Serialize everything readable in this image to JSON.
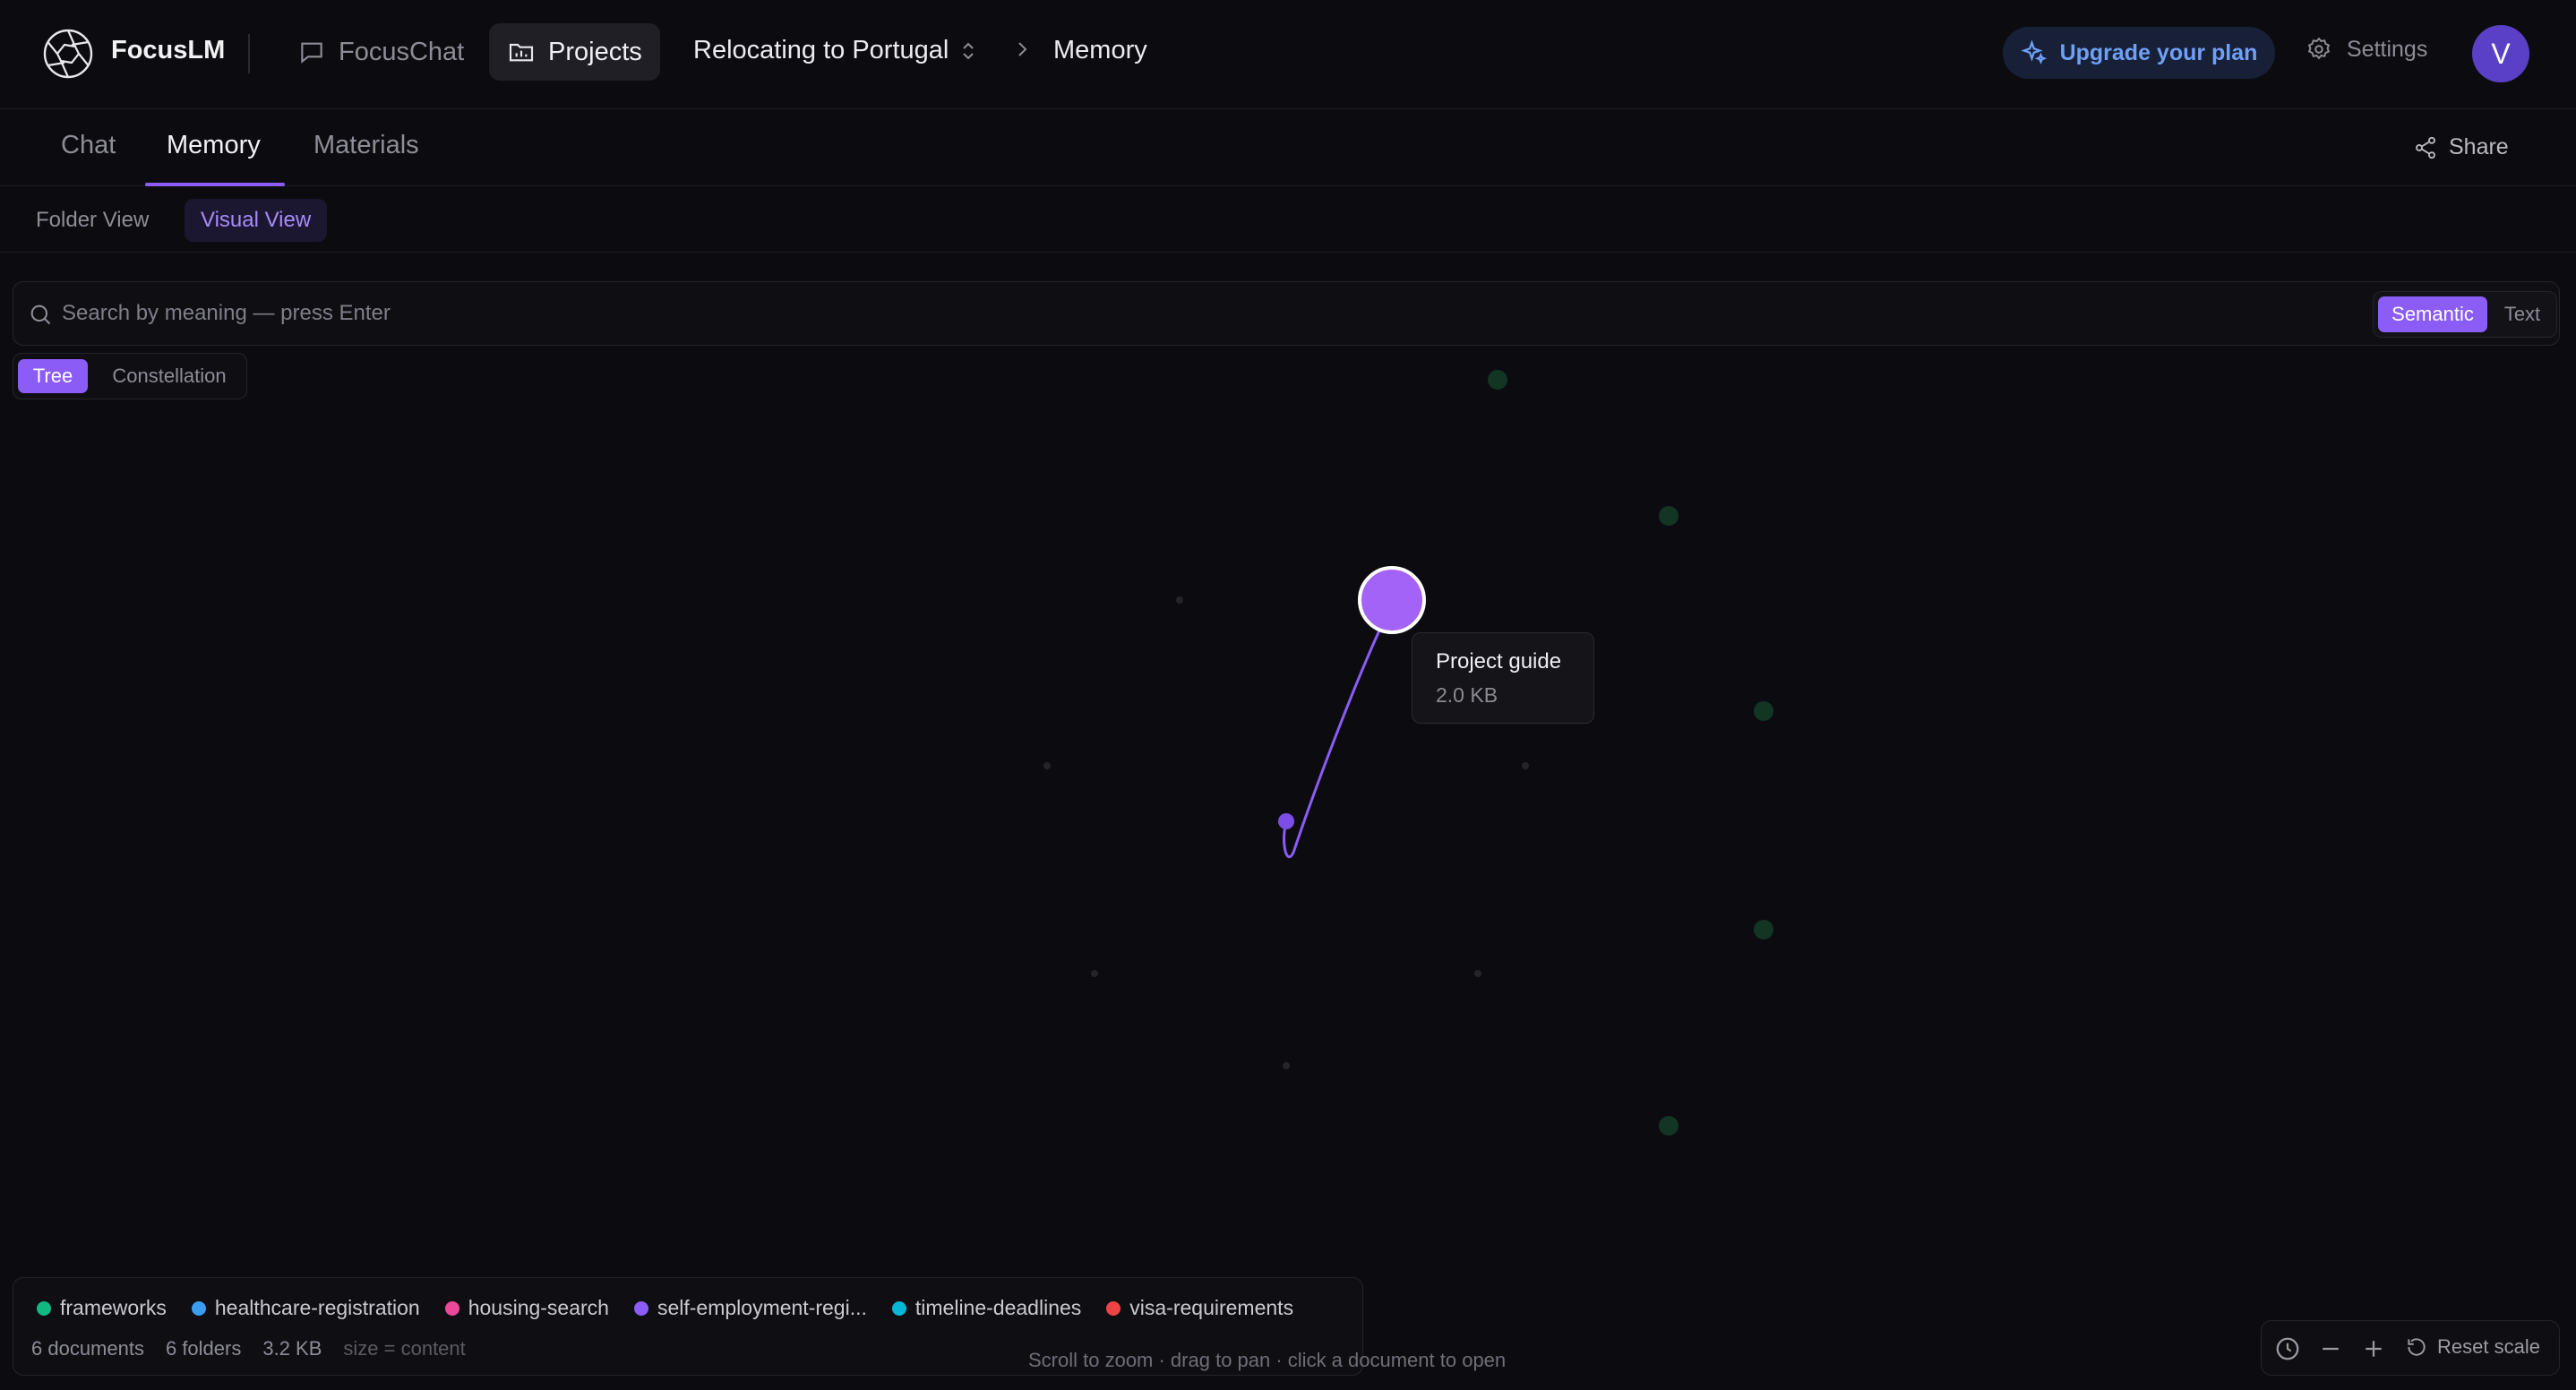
{
  "app": {
    "brand": "FocusLM",
    "nav": {
      "focuschat": "FocusChat",
      "projects": "Projects"
    },
    "breadcrumb": {
      "project": "Relocating to Portugal",
      "current": "Memory"
    },
    "upgrade_label": "Upgrade your plan",
    "settings_label": "Settings",
    "avatar_initial": "V"
  },
  "tabs": {
    "chat": "Chat",
    "memory": "Memory",
    "materials": "Materials",
    "share": "Share"
  },
  "views": {
    "folder": "Folder View",
    "visual": "Visual View"
  },
  "search": {
    "placeholder": "Search by meaning — press Enter",
    "modes": {
      "semantic": "Semantic",
      "text": "Text"
    },
    "active_mode": "Semantic"
  },
  "layout_modes": {
    "tree": "Tree",
    "constellation": "Constellation",
    "active": "Tree"
  },
  "graph": {
    "selected_document": {
      "title": "Project guide",
      "size": "2.0 KB"
    },
    "node_color": "#a463f7",
    "edge_color": "#8b5cf6",
    "folder_node_color": "#123524"
  },
  "legend": {
    "items": [
      {
        "label": "frameworks",
        "color": "#10b981"
      },
      {
        "label": "healthcare-registration",
        "color": "#3b9ef5"
      },
      {
        "label": "housing-search",
        "color": "#ec4899"
      },
      {
        "label": "self-employment-regi...",
        "color": "#8b5cf6"
      },
      {
        "label": "timeline-deadlines",
        "color": "#06b6d4"
      },
      {
        "label": "visa-requirements",
        "color": "#ef4444"
      }
    ],
    "stats": {
      "documents": "6 documents",
      "folders": "6 folders",
      "size": "3.2 KB",
      "size_hint": "size = content"
    }
  },
  "hint": "Scroll to zoom · drag to pan · click a document to open",
  "zoom": {
    "reset_label": "Reset scale"
  },
  "accent": "#8b5cf6"
}
